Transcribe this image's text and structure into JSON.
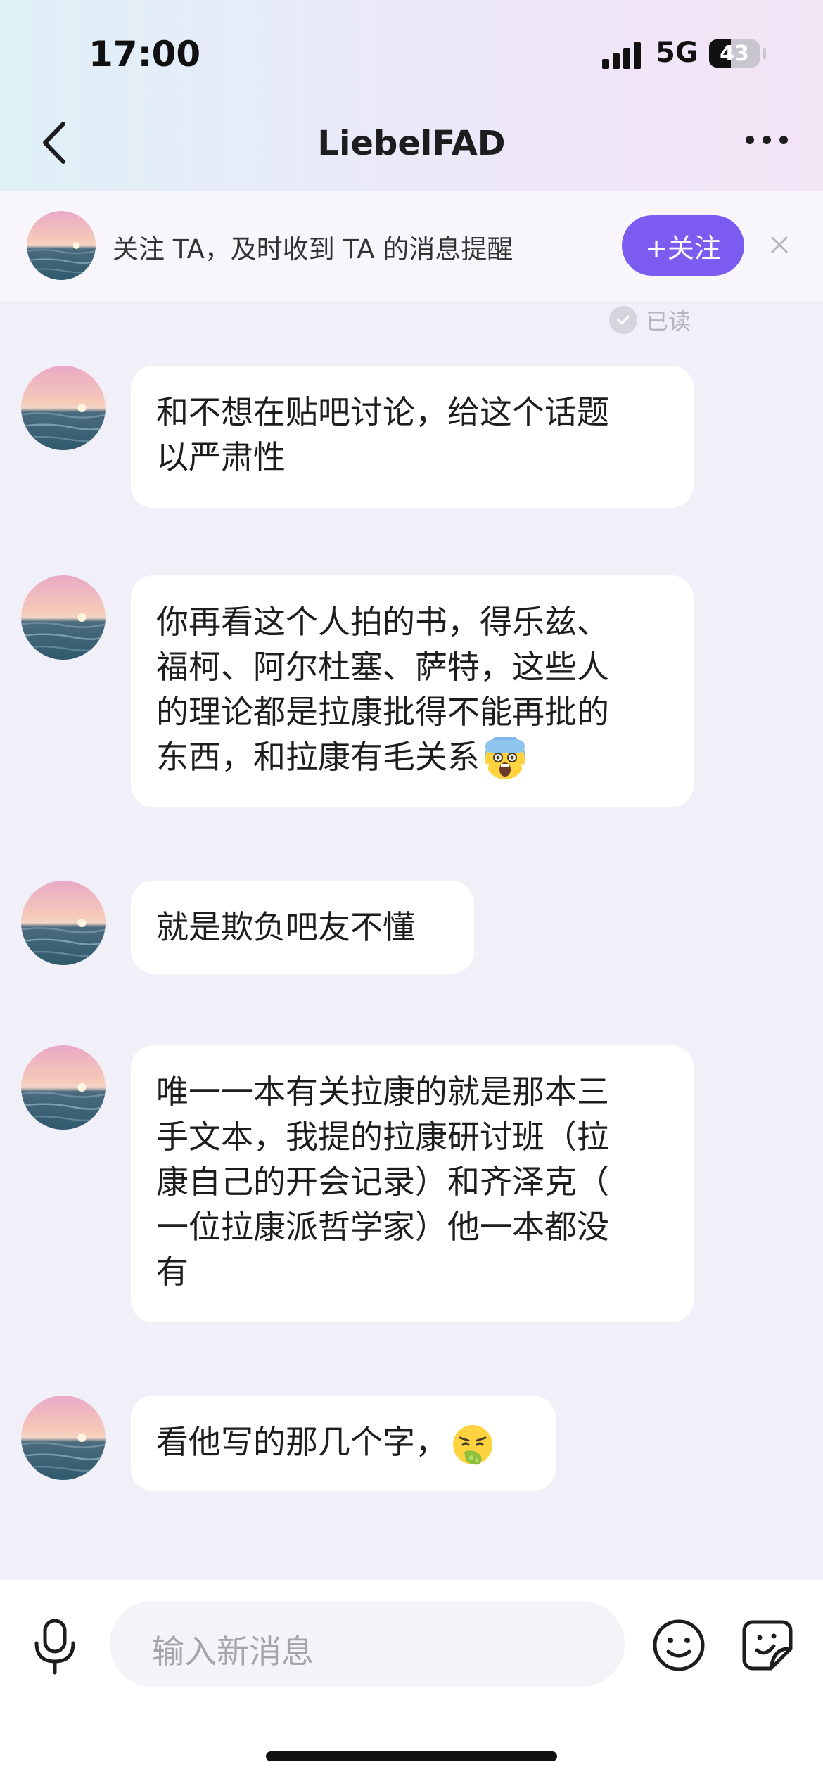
{
  "status": {
    "time": "17:00",
    "network": "5G",
    "battery": "43",
    "battery_level": 0.43
  },
  "header": {
    "title": "LiebelFAD",
    "back_icon": "chevron-left-icon",
    "more_icon": "more-dots-icon"
  },
  "follow_banner": {
    "text": "关注 TA，及时收到 TA 的消息提醒",
    "button": "+关注",
    "close_icon": "close-icon"
  },
  "read_status": "已读",
  "messages": [
    {
      "lines": [
        "和不想在贴吧讨论，给这个话题",
        "以严肃性"
      ]
    },
    {
      "lines": [
        "你再看这个人拍的书，得乐兹、",
        "福柯、阿尔杜塞、萨特，这些人",
        "的理论都是拉康批得不能再批的",
        "东西，和拉康有毛关系"
      ],
      "emoji": "screaming-face-emoji"
    },
    {
      "lines": [
        "就是欺负吧友不懂"
      ]
    },
    {
      "lines": [
        "唯一一本有关拉康的就是那本三",
        "手文本，我提的拉康研讨班（拉",
        "康自己的开会记录）和齐泽克（",
        "一位拉康派哲学家）他一本都没",
        "有"
      ]
    },
    {
      "lines": [
        "看他写的那几个字，"
      ],
      "emoji": "vomiting-face-emoji"
    }
  ],
  "input": {
    "placeholder": "输入新消息"
  },
  "colors": {
    "accent": "#7b5bf0",
    "bubble": "#ffffff",
    "background": "#f1eff8"
  }
}
